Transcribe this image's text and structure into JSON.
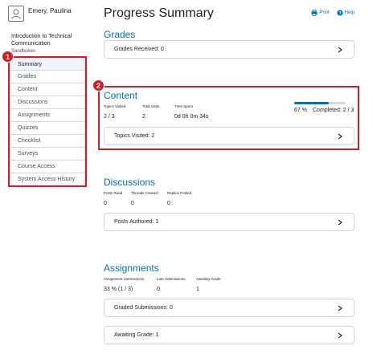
{
  "user": {
    "name": "Emery, Paulina",
    "avatar_icon": "user-avatar-icon"
  },
  "course": {
    "title": "Introduction to Technical Communication",
    "subtitle": "Sandboxes"
  },
  "nav": {
    "items": [
      {
        "label": "Summary",
        "active": true
      },
      {
        "label": "Grades"
      },
      {
        "label": "Content"
      },
      {
        "label": "Discussions"
      },
      {
        "label": "Assignments"
      },
      {
        "label": "Quizzes"
      },
      {
        "label": "Checklist"
      },
      {
        "label": "Surveys"
      },
      {
        "label": "Course Access"
      },
      {
        "label": "System Access History"
      }
    ]
  },
  "callouts": [
    "1",
    "2"
  ],
  "page": {
    "title": "Progress Summary",
    "print_label": "Print",
    "help_label": "Help"
  },
  "grades": {
    "heading": "Grades",
    "received_label": "Grades Received: 0"
  },
  "content": {
    "heading": "Content",
    "topics_visited_label": "Topics Visited",
    "topics_visited_value": "2 / 3",
    "total_visits_label": "Total Visits",
    "total_visits_value": "2",
    "time_spent_label": "Time Spent",
    "time_spent_value": "0d 0h 0m 34s",
    "progress_fraction": 0.67,
    "progress_percent_label": "67 %",
    "completed_label": "Completed: 2 / 3",
    "topics_visited_panel": "Topics Visited: 2"
  },
  "discussions": {
    "heading": "Discussions",
    "posts_read_label": "Posts Read",
    "posts_read_value": "0",
    "threads_created_label": "Threads Created",
    "threads_created_value": "0",
    "replies_posted_label": "Replies Posted",
    "replies_posted_value": "0",
    "posts_authored_panel": "Posts Authored: 1"
  },
  "assignments": {
    "heading": "Assignments",
    "submissions_label": "Assignment Submissions",
    "submissions_value": "33 % (1 / 3)",
    "late_label": "Late Submissions",
    "late_value": "0",
    "awaiting_label": "Awaiting Grade",
    "awaiting_value": "1",
    "graded_panel": "Graded Submissions: 0",
    "awaiting_panel": "Awaiting Grade: 1"
  },
  "colors": {
    "accent": "#006fbf",
    "callout": "#cd2026",
    "panel_border": "#cdd5dc"
  }
}
